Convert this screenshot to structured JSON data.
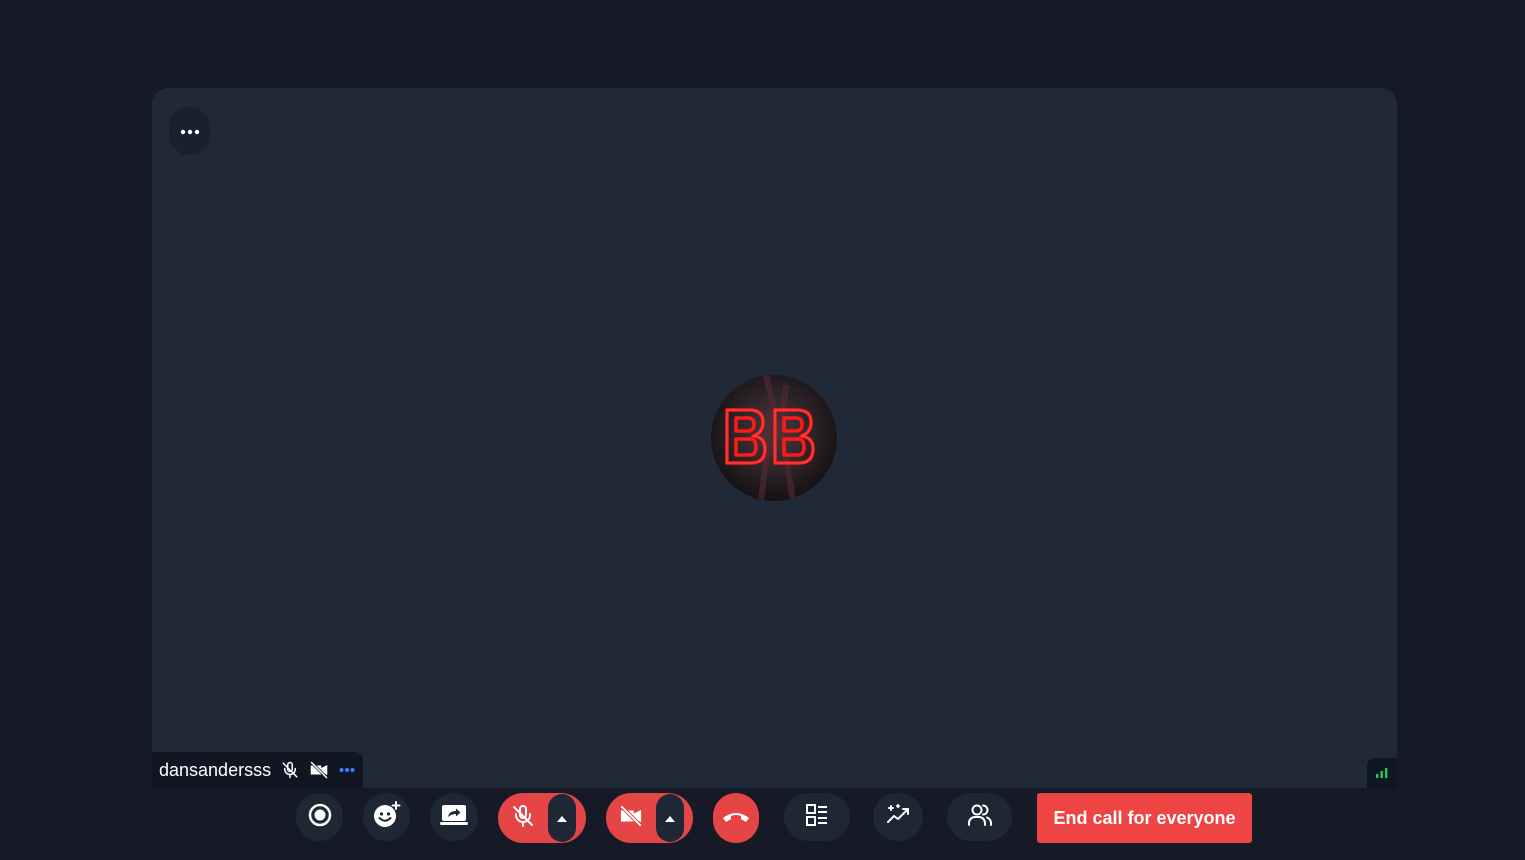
{
  "participant": {
    "name": "dansandersss",
    "mic_state": "muted",
    "camera_state": "off",
    "avatar_monogram": "BB"
  },
  "icons": {
    "tile_menu": "more-horizontal-icon",
    "name_mic": "mic-off-icon",
    "name_camera": "video-off-icon",
    "name_more": "more-horizontal-icon",
    "signal": "signal-strength-icon",
    "record": "record-icon",
    "reactions": "emoji-add-icon",
    "share_screen": "screen-share-icon",
    "mic": "mic-off-icon",
    "camera": "video-off-icon",
    "leave": "phone-hangup-icon",
    "layout": "layout-icon",
    "effects": "sparkle-trend-icon",
    "participants": "people-icon",
    "caret": "caret-up-icon"
  },
  "toolbar": {
    "end_call_all_label": "End call for everyone"
  },
  "colors": {
    "page_bg": "#161a27",
    "stage_bg": "#1f2938",
    "button_bg": "#1e2734",
    "danger": "#ef4444",
    "accent": "#3b82f6",
    "signal": "#22c55e"
  }
}
